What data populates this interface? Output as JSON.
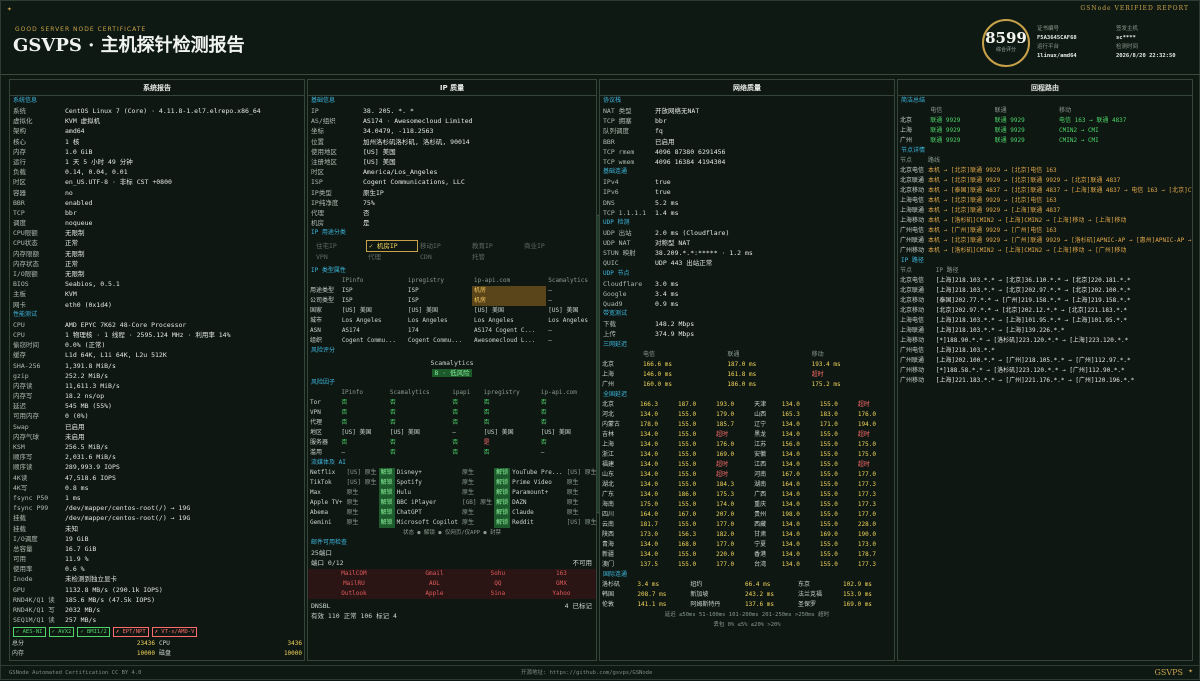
{
  "header": {
    "subtitle": "GOOD SERVER NODE CERTIFICATE",
    "title": "GSVPS · 主机探针检测报告",
    "verified": "GSNode VERIFIED REPORT",
    "score": "8599",
    "score_label": "综合评分",
    "meta": [
      {
        "k": "证书编号",
        "v": "F5A3645CAF68"
      },
      {
        "k": "运行平台",
        "v": "1linux/amd64"
      },
      {
        "k": "签发主机",
        "v": "sc****"
      },
      {
        "k": "检测时间",
        "v": "2026/8/20 22:32:50"
      }
    ]
  },
  "system": {
    "title": "系统报告",
    "sections": [
      {
        "name": "系统信息",
        "rows": [
          [
            "系统",
            "CentOS Linux 7 (Core) · 4.11.8-1.el7.elrepo.x86_64"
          ],
          [
            "虚拟化",
            "KVM 虚拟机"
          ],
          [
            "架构",
            "amd64"
          ],
          [
            "核心",
            "1 核"
          ],
          [
            "内存",
            "1.0 GiB"
          ],
          [
            "运行",
            "1 天 5 小时 49 分钟"
          ],
          [
            "负载",
            "0.14, 0.04, 0.01"
          ],
          [
            "时区",
            "en_US.UTF-8 · 非标 CST +0800"
          ],
          [
            "容器",
            "no"
          ],
          [
            "BBR",
            "enabled"
          ],
          [
            "TCP",
            "bbr"
          ],
          [
            "调度",
            "noqueue"
          ],
          [
            "CPU限额",
            "无限制"
          ],
          [
            "CPU状态",
            "正常"
          ],
          [
            "内存限额",
            "无限制"
          ],
          [
            "内存状态",
            "正常"
          ],
          [
            "I/O限额",
            "无限制"
          ],
          [
            "BIOS",
            "Seabios, 0.5.1"
          ],
          [
            "主板",
            "KVM"
          ],
          [
            "网卡",
            "eth0 (0x1d4)"
          ]
        ]
      },
      {
        "name": "性能测试",
        "rows": [
          [
            "CPU",
            "AMD EPYC 7K62 48-Core Processor"
          ],
          [
            "CPU",
            "1 物理核 · 1 线程 · 2595.124 MHz · 利用率 14%"
          ],
          [
            "偷窃时间",
            "0.0% (正常)"
          ],
          [
            "缓存",
            "L1d 64K, L1i 64K, L2u 512K"
          ],
          [
            "SHA-256",
            "1,391.8 MiB/s"
          ],
          [
            "gzip",
            "252.2 MiB/s"
          ],
          [
            "内存读",
            "11,611.3 MiB/s"
          ],
          [
            "内存写",
            "18.2 ns/op"
          ],
          [
            "延迟",
            "545 MB (55%)"
          ],
          [
            "可用内存",
            "0 (0%)"
          ],
          [
            "Swap",
            "已启用"
          ],
          [
            "内存气球",
            "未启用"
          ],
          [
            "KSM",
            "256.5 MiB/s"
          ],
          [
            "顺序写",
            "2,031.6 MiB/s"
          ],
          [
            "顺序读",
            "289,993.9 IOPS"
          ],
          [
            "4K读",
            "47,518.6 IOPS"
          ],
          [
            "4K写",
            "0.8 ms"
          ],
          [
            "fsync P50",
            "1 ms"
          ],
          [
            "fsync P99",
            "/dev/mapper/centos-root(/) → 19G"
          ],
          [
            "挂载",
            "/dev/mapper/centos-root(/) → 19G"
          ],
          [
            "挂载",
            "未知"
          ],
          [
            "I/O调度",
            "19 GiB"
          ],
          [
            "总容量",
            "16.7 GiB"
          ],
          [
            "可用",
            "11.9 %"
          ],
          [
            "使用率",
            "0.6 %"
          ],
          [
            "Inode",
            "未检测到独立显卡"
          ],
          [
            "GPU",
            "1132.8 MB/s (290.1k IOPS)"
          ],
          [
            "RND4K/Q1 读",
            "185.6 MB/s (47.5k IOPS)"
          ],
          [
            "RND4K/Q1 写",
            "2032 MB/s"
          ],
          [
            "SEQ1M/Q1 读",
            "257 MB/s"
          ]
        ]
      }
    ],
    "flags": [
      {
        "t": "✓ AES-NI",
        "c": "g"
      },
      {
        "t": "✓ AVX2",
        "c": "g"
      },
      {
        "t": "✓ BMI1/2",
        "c": "g"
      },
      {
        "t": "✗ EPT/NPT",
        "c": "r"
      },
      {
        "t": "✗ VT-x/AMD-V",
        "c": "r"
      }
    ],
    "totals": [
      [
        "总分",
        "23436",
        "CPU",
        "3436"
      ],
      [
        "内存",
        "10000",
        "磁盘",
        "10000"
      ]
    ]
  },
  "ip": {
    "title": "IP 质量",
    "basic": [
      [
        "IP",
        "38. 205. *. *"
      ],
      [
        "AS/组织",
        "AS174 · Awesomecloud Limited"
      ],
      [
        "坐标",
        "34.0479, -118.2563"
      ],
      [
        "位置",
        "加州洛杉矶洛杉矶, 洛杉矶, 90014"
      ],
      [
        "使用地区",
        "[US] 美国"
      ],
      [
        "注册地区",
        "[US] 美国"
      ],
      [
        "时区",
        "America/Los_Angeles"
      ],
      [
        "ISP",
        "Cogent Communications, LLC"
      ],
      [
        "IP类型",
        "原生IP"
      ],
      [
        "IP纯净度",
        "75%"
      ],
      [
        "代理",
        "否"
      ],
      [
        "机房",
        "是"
      ]
    ],
    "ip_types": [
      "住宅IP",
      "机房IP",
      "移动IP",
      "教育IP",
      "商业IP",
      "VPN",
      "代理",
      "CDN",
      "托管"
    ],
    "attr_head": [
      "",
      "IPinfo",
      "ipregistry",
      "ip-api.com",
      "Scamalytics"
    ],
    "attr_rows": [
      [
        "用途类型",
        "ISP",
        "ISP",
        "机房",
        "—"
      ],
      [
        "公司类型",
        "ISP",
        "ISP",
        "机房",
        "—"
      ],
      [
        "国家",
        "[US] 美国",
        "[US] 美国",
        "[US] 美国",
        "[US] 美国"
      ],
      [
        "城市",
        "Los Angeles",
        "Los Angeles",
        "Los Angeles",
        "Los Angeles"
      ],
      [
        "ASN",
        "AS174",
        "174",
        "AS174 Cogent C...",
        "—"
      ],
      [
        "组织",
        "Cogent Commu...",
        "Cogent Commu...",
        "Awesomecloud L...",
        "—"
      ]
    ],
    "risk_label": "Scamalytics",
    "risk_value": "8 · 低风险",
    "risk_head": [
      "",
      "IPinfo",
      "Scamalytics",
      "ipapi",
      "ipregistry",
      "ip-api.com"
    ],
    "risk_rows": [
      [
        "Tor",
        "否",
        "否",
        "否",
        "否",
        "否"
      ],
      [
        "VPN",
        "否",
        "否",
        "否",
        "否",
        "否"
      ],
      [
        "代理",
        "否",
        "否",
        "否",
        "否",
        "否"
      ],
      [
        "地区",
        "[US] 美国",
        "[US] 美国",
        "—",
        "[US] 美国",
        "[US] 美国"
      ],
      [
        "服务器",
        "否",
        "否",
        "否",
        "是",
        "否"
      ],
      [
        "滥用",
        "—",
        "否",
        "否",
        "否",
        "—"
      ]
    ],
    "unlock": [
      [
        "Netflix",
        "[US] 原生",
        "解锁",
        "Disney+",
        "原生",
        "解锁",
        "YouTube Pre...",
        "[US] 原生",
        "解锁"
      ],
      [
        "TikTok",
        "[US] 原生",
        "解锁",
        "Spotify",
        "原生",
        "解锁",
        "Prime Video",
        "原生",
        "解锁"
      ],
      [
        "Max",
        "原生",
        "解锁",
        "Hulu",
        "原生",
        "解锁",
        "Paramount+",
        "原生",
        "解锁"
      ],
      [
        "Apple TV+",
        "原生",
        "解锁",
        "BBC iPlayer",
        "[GB] 原生",
        "解锁",
        "DAZN",
        "原生",
        "解锁"
      ],
      [
        "Abema",
        "原生",
        "解锁",
        "ChatGPT",
        "原生",
        "解锁",
        "Claude",
        "原生",
        "解锁"
      ],
      [
        "Gemini",
        "原生",
        "解锁",
        "Microsoft Copilot",
        "原生",
        "解锁",
        "Reddit",
        "[US] 原生",
        "解锁"
      ]
    ],
    "legend": "状态 ● 解锁 ● 仅网页/仅APP ● 封禁",
    "mail_title": "邮件可用检查",
    "smtp": "25端口",
    "port_label": "端口 0/12",
    "port_status": "不可用",
    "mail": [
      [
        "MailCOM",
        "Gmail",
        "Sohu",
        "163"
      ],
      [
        "MailRU",
        "AOL",
        "QQ",
        "GMX"
      ],
      [
        "Outlook",
        "Apple",
        "Sina",
        "Yahoo"
      ]
    ],
    "dnsbl": "DNSBL",
    "dnsbl_count": "4 已标记",
    "dnsbl_stats": "有效 110  正常 106  标记 4"
  },
  "net": {
    "title": "网络质量",
    "sections": {
      "stack": "协议栈",
      "base": "基础连通",
      "udp": "UDP 检测",
      "udp2": "UDP 节点",
      "speed": "带宽测试",
      "three": "三网延迟",
      "all": "全国延迟"
    },
    "stack": [
      [
        "NAT 类型",
        "开放网络无NAT"
      ],
      [
        "TCP 拥塞",
        "bbr"
      ],
      [
        "队列调度",
        "fq"
      ],
      [
        "BBR",
        "已启用"
      ],
      [
        "TCP rmem",
        "4096 87380 6291456"
      ],
      [
        "TCP wmem",
        "4096 16384 4194304"
      ]
    ],
    "base": [
      [
        "IPv4",
        "true"
      ],
      [
        "IPv6",
        "true"
      ],
      [
        "DNS",
        "5.2 ms"
      ],
      [
        "TCP 1.1.1.1",
        "1.4 ms"
      ]
    ],
    "udp": [
      [
        "UDP 出站",
        "2.0 ms (Cloudflare)"
      ],
      [
        "UDP NAT",
        "对称型 NAT"
      ],
      [
        "STUN 映射",
        "38.209.*.*:***** · 1.2 ms"
      ],
      [
        "QUIC",
        "UDP 443 出站正常"
      ]
    ],
    "udp2": [
      [
        "Cloudflare",
        "3.0 ms"
      ],
      [
        "Google",
        "3.4 ms"
      ],
      [
        "Quad9",
        "0.9 ms"
      ]
    ],
    "speed": [
      [
        "下载",
        "148.2 Mbps"
      ],
      [
        "上传",
        "374.9 Mbps"
      ]
    ],
    "three_head": [
      "",
      "电信",
      "联通",
      "移动"
    ],
    "three": [
      [
        "北京",
        "166.6 ms",
        "187.0 ms",
        "193.4 ms"
      ],
      [
        "上海",
        "146.0 ms",
        "161.8 ms",
        "超时"
      ],
      [
        "广州",
        "160.0 ms",
        "186.0 ms",
        "175.2 ms"
      ]
    ],
    "prov": [
      [
        "北京",
        "166.3",
        "187.0",
        "193.0",
        "天津",
        "134.0",
        "155.0",
        "超时"
      ],
      [
        "河北",
        "134.0",
        "155.0",
        "179.0",
        "山西",
        "165.3",
        "183.0",
        "176.0"
      ],
      [
        "内蒙古",
        "178.0",
        "155.0",
        "185.7",
        "辽宁",
        "134.0",
        "171.0",
        "194.0"
      ],
      [
        "吉林",
        "134.0",
        "155.0",
        "超时",
        "黑龙",
        "134.0",
        "155.0",
        "超时"
      ],
      [
        "上海",
        "134.0",
        "155.0",
        "176.0",
        "江苏",
        "156.0",
        "155.0",
        "175.0"
      ],
      [
        "浙江",
        "134.0",
        "155.0",
        "169.0",
        "安徽",
        "134.0",
        "155.0",
        "175.0"
      ],
      [
        "福建",
        "134.0",
        "155.0",
        "超时",
        "江西",
        "134.0",
        "155.0",
        "超时"
      ],
      [
        "山东",
        "134.0",
        "155.0",
        "超时",
        "河南",
        "167.0",
        "155.0",
        "177.0"
      ],
      [
        "湖北",
        "134.0",
        "155.0",
        "184.3",
        "湖南",
        "164.0",
        "155.0",
        "177.3"
      ],
      [
        "广东",
        "134.0",
        "186.0",
        "175.3",
        "广西",
        "134.0",
        "155.0",
        "177.3"
      ],
      [
        "海南",
        "175.0",
        "155.0",
        "174.0",
        "重庆",
        "134.0",
        "155.0",
        "177.3"
      ],
      [
        "四川",
        "164.0",
        "167.0",
        "207.0",
        "贵州",
        "198.0",
        "155.0",
        "177.0"
      ],
      [
        "云南",
        "181.7",
        "155.0",
        "177.0",
        "西藏",
        "134.0",
        "155.0",
        "228.0"
      ],
      [
        "陕西",
        "173.0",
        "156.3",
        "182.0",
        "甘肃",
        "134.0",
        "169.0",
        "190.0"
      ],
      [
        "青海",
        "134.0",
        "168.0",
        "177.0",
        "宁夏",
        "134.0",
        "155.0",
        "173.0"
      ],
      [
        "新疆",
        "134.0",
        "155.0",
        "220.0",
        "香港",
        "134.0",
        "155.0",
        "178.7"
      ],
      [
        "澳门",
        "137.5",
        "155.0",
        "177.0",
        "台湾",
        "134.0",
        "155.0",
        "177.3"
      ]
    ],
    "intl_title": "国际连通",
    "intl": [
      [
        "洛杉矶",
        "3.4 ms",
        "纽约",
        "66.4 ms",
        "东京",
        "102.9 ms"
      ],
      [
        "韩国",
        "208.7 ms",
        "新加坡",
        "243.2 ms",
        "法兰克福",
        "153.9 ms"
      ],
      [
        "伦敦",
        "141.1 ms",
        "阿姆斯特丹",
        "137.6 ms",
        "圣保罗",
        "169.0 ms"
      ]
    ],
    "lat_legend": "延迟 ≤50ms  51-100ms  101-200ms  201-250ms  >250ms  超时",
    "loss_legend": "丢包 0%  ≤5%  ≤20%  >20%"
  },
  "route": {
    "title": "回程路由",
    "sum_title": "简洁总结",
    "sum_head": [
      "",
      "电信",
      "联通",
      "移动"
    ],
    "sum": [
      [
        "北京",
        "联通 9929",
        "联通 9929",
        "电信 163 → 联通 4837"
      ],
      [
        "上海",
        "联通 9929",
        "联通 9929",
        "CMIN2 → CMI"
      ],
      [
        "广州",
        "联通 9929",
        "联通 9929",
        "CMIN2 → CMI"
      ]
    ],
    "node_title": "节点详情",
    "node_head": [
      "节点",
      "路线",
      "延迟"
    ],
    "nodes": [
      [
        "北京电信",
        "本机 → [北京]联通 9929 → [北京]电信 163",
        "166.6 ms"
      ],
      [
        "北京联通",
        "本机 → [北京]联通 9929 → [北京]联通 9929 → [北京]联通 4837",
        "187.0 ms"
      ],
      [
        "北京移动",
        "本机 → [泰国]联通 4837 → [北京]联通 4837 → [上海]联通 4837 → 电信 163 → [北京]CTSNET",
        "193.4 ms"
      ],
      [
        "上海电信",
        "本机 → [北京]联通 9929 → [北京]电信 163",
        "146.0 ms"
      ],
      [
        "上海联通",
        "本机 → [北京]联通 9929 → [上海]联通 4837",
        "161.8 ms"
      ],
      [
        "上海移动",
        "本机 → [洛杉矶]CMIN2 → [上海]CMIN2 → [上海]移动 → [上海]移动",
        "超时"
      ],
      [
        "广州电信",
        "本机 → [广州]联通 9929 → [广州]电信 163",
        "160.0 ms"
      ],
      [
        "广州联通",
        "本机 → [北京]联通 9929 → [广州]联通 9929 → [洛杉矶]APNIC-AP → [惠州]APNIC-AP → [惠州]APNIC-AP",
        "186.0 ms"
      ],
      [
        "广州移动",
        "本机 → [洛杉矶]CMIN2 → [上海]CMIN2 → [上海]移动 → [广州]移动",
        "175.2 ms"
      ]
    ],
    "ip_title": "IP 路径",
    "ip_head": [
      "节点",
      "IP 路径"
    ],
    "ips": [
      [
        "北京电信",
        "[上海]218.103.*.* → [北京]36.110.*.* → [北京]220.181.*.*"
      ],
      [
        "北京联通",
        "[上海]218.103.*.* → [北京]202.97.*.* → [北京]202.100.*.*"
      ],
      [
        "北京移动",
        "[泰国]202.77.*.* → [广州]219.158.*.* → [上海]219.158.*.*"
      ],
      [
        "北京移动",
        "[北京]202.97.*.* → [北京]202.12.*.* → [北京]221.183.*.*"
      ],
      [
        "上海电信",
        "[上海]218.103.*.* → [上海]101.95.*.* → [上海]101.95.*.*"
      ],
      [
        "上海联通",
        "[上海]218.103.*.* → [上海]139.226.*.*"
      ],
      [
        "上海移动",
        "[*]188.90.*.* → [洛杉矶]223.120.*.* → [上海]223.120.*.*"
      ],
      [
        "广州电信",
        "[上海]218.103.*.*"
      ],
      [
        "广州联通",
        "[上海]202.100.*.* → [广州]218.105.*.* → [广州]112.97.*.*"
      ],
      [
        "广州移动",
        "[*]188.58.*.* → [洛杉矶]223.120.*.* → [广州]112.90.*.*"
      ],
      [
        "广州移动",
        "[上海]221.183.*.* → [广州]221.176.*.* → [广州]120.196.*.*"
      ]
    ]
  },
  "footer": {
    "left": "GSNode Automated Certification CC BY 4.0",
    "center": "开源地址: https://github.com/gsvps/GSNode",
    "brand": "GSVPS"
  }
}
